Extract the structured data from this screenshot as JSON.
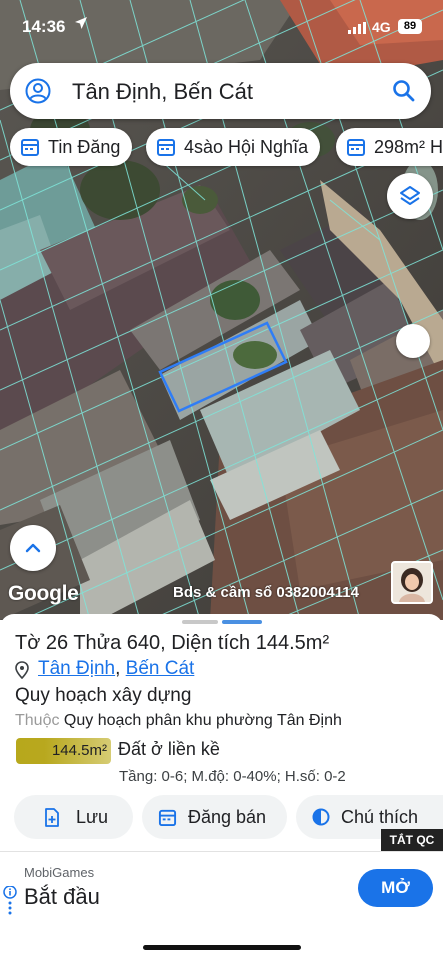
{
  "status_bar": {
    "time": "14:36",
    "network": "4G",
    "battery": "89"
  },
  "search": {
    "query": "Tân Định, Bến Cát"
  },
  "chips": [
    {
      "label": "Tin Đăng"
    },
    {
      "label": "4sào Hội Nghĩa"
    },
    {
      "label": "298m² H"
    }
  ],
  "map": {
    "attribution": "Google",
    "watermark": "Bds & cầm sổ 0382004114"
  },
  "parcel": {
    "sheet_prefix": "Tờ ",
    "sheet_no": "26",
    "lot_prefix": " Thửa ",
    "lot_no": "640",
    "area_label": ", Diện tích ",
    "area_value": "144.5m²",
    "ward": "Tân Định",
    "separator": ", ",
    "district": "Bến Cát"
  },
  "planning": {
    "heading": "Quy hoạch xây dựng",
    "ref_prefix": "Thuộc ",
    "ref_name": "Quy hoạch phân khu phường Tân Định",
    "area": "144.5m²",
    "zone_type": "Đất ở liền kề",
    "params": "Tầng: 0-6; M.độ: 0-40%; H.số: 0-2",
    "badge_color": "#b7a81c"
  },
  "actions": {
    "save": "Lưu",
    "post": "Đăng bán",
    "legend": "Chú thích"
  },
  "ad": {
    "close_label": "TẮT QC",
    "sponsor": "MobiGames",
    "headline": "Bắt đầu",
    "cta": "MỞ"
  },
  "colors": {
    "accent": "#1a73e8",
    "parcel_outline": "#2f7df6",
    "plan_lines": "#7fe6da"
  }
}
